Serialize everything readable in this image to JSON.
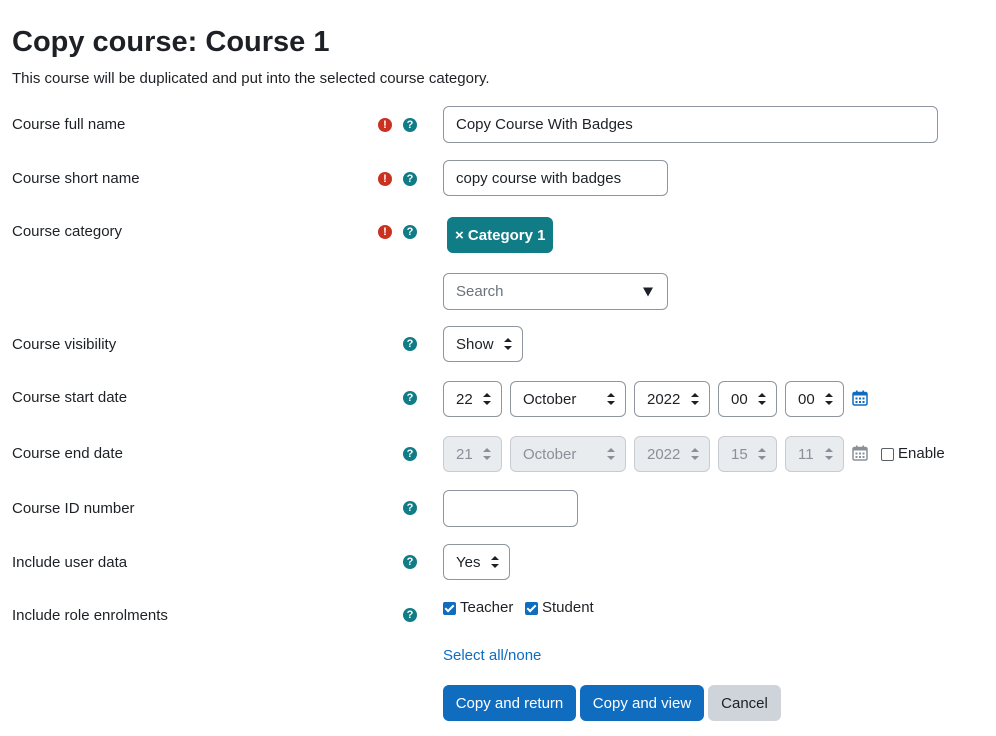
{
  "page": {
    "title": "Copy course: Course 1",
    "description": "This course will be duplicated and put into the selected course category."
  },
  "fields": {
    "fullname": {
      "label": "Course full name",
      "value": "Copy Course With Badges"
    },
    "shortname": {
      "label": "Course short name",
      "value": "copy course with badges"
    },
    "category": {
      "label": "Course category",
      "selected": "× Category 1",
      "search_placeholder": "Search"
    },
    "visibility": {
      "label": "Course visibility",
      "value": "Show"
    },
    "startdate": {
      "label": "Course start date",
      "day": "22",
      "month": "October",
      "year": "2022",
      "hour": "00",
      "minute": "00"
    },
    "enddate": {
      "label": "Course end date",
      "day": "21",
      "month": "October",
      "year": "2022",
      "hour": "15",
      "minute": "11",
      "enable_label": "Enable",
      "enabled": false
    },
    "idnumber": {
      "label": "Course ID number",
      "value": ""
    },
    "userdata": {
      "label": "Include user data",
      "value": "Yes"
    },
    "roles": {
      "label": "Include role enrolments",
      "teacher_label": "Teacher",
      "teacher_checked": true,
      "student_label": "Student",
      "student_checked": true,
      "select_all_label": "Select all/none"
    }
  },
  "icons": {
    "required": "exclamation-circle-icon",
    "help": "question-circle-icon",
    "calendar": "calendar-icon"
  },
  "buttons": {
    "copy_return": "Copy and return",
    "copy_view": "Copy and view",
    "cancel": "Cancel"
  },
  "glyphs": {
    "required": "!",
    "help": "?"
  },
  "colors": {
    "primary": "#0f6cbf",
    "accent": "#0f7c86",
    "required": "#ca3120"
  }
}
